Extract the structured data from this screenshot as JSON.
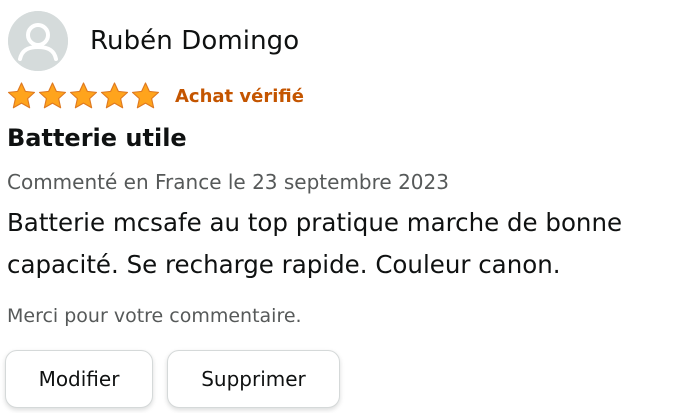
{
  "profile": {
    "name": "Rubén Domingo",
    "avatar_icon": "user-silhouette-icon"
  },
  "rating": {
    "stars": 5,
    "max": 5,
    "star_color": "#ffa41c",
    "verified_label": "Achat vérifié",
    "verified_color": "#c45500"
  },
  "review": {
    "title": "Batterie utile",
    "date_line": "Commenté en France le 23 septembre 2023",
    "body": "Batterie mcsafe au top pratique marche de bonne capacité. Se recharge rapide. Couleur canon."
  },
  "feedback": {
    "thanks": "Merci pour votre commentaire."
  },
  "actions": {
    "edit_label": "Modifier",
    "delete_label": "Supprimer"
  }
}
